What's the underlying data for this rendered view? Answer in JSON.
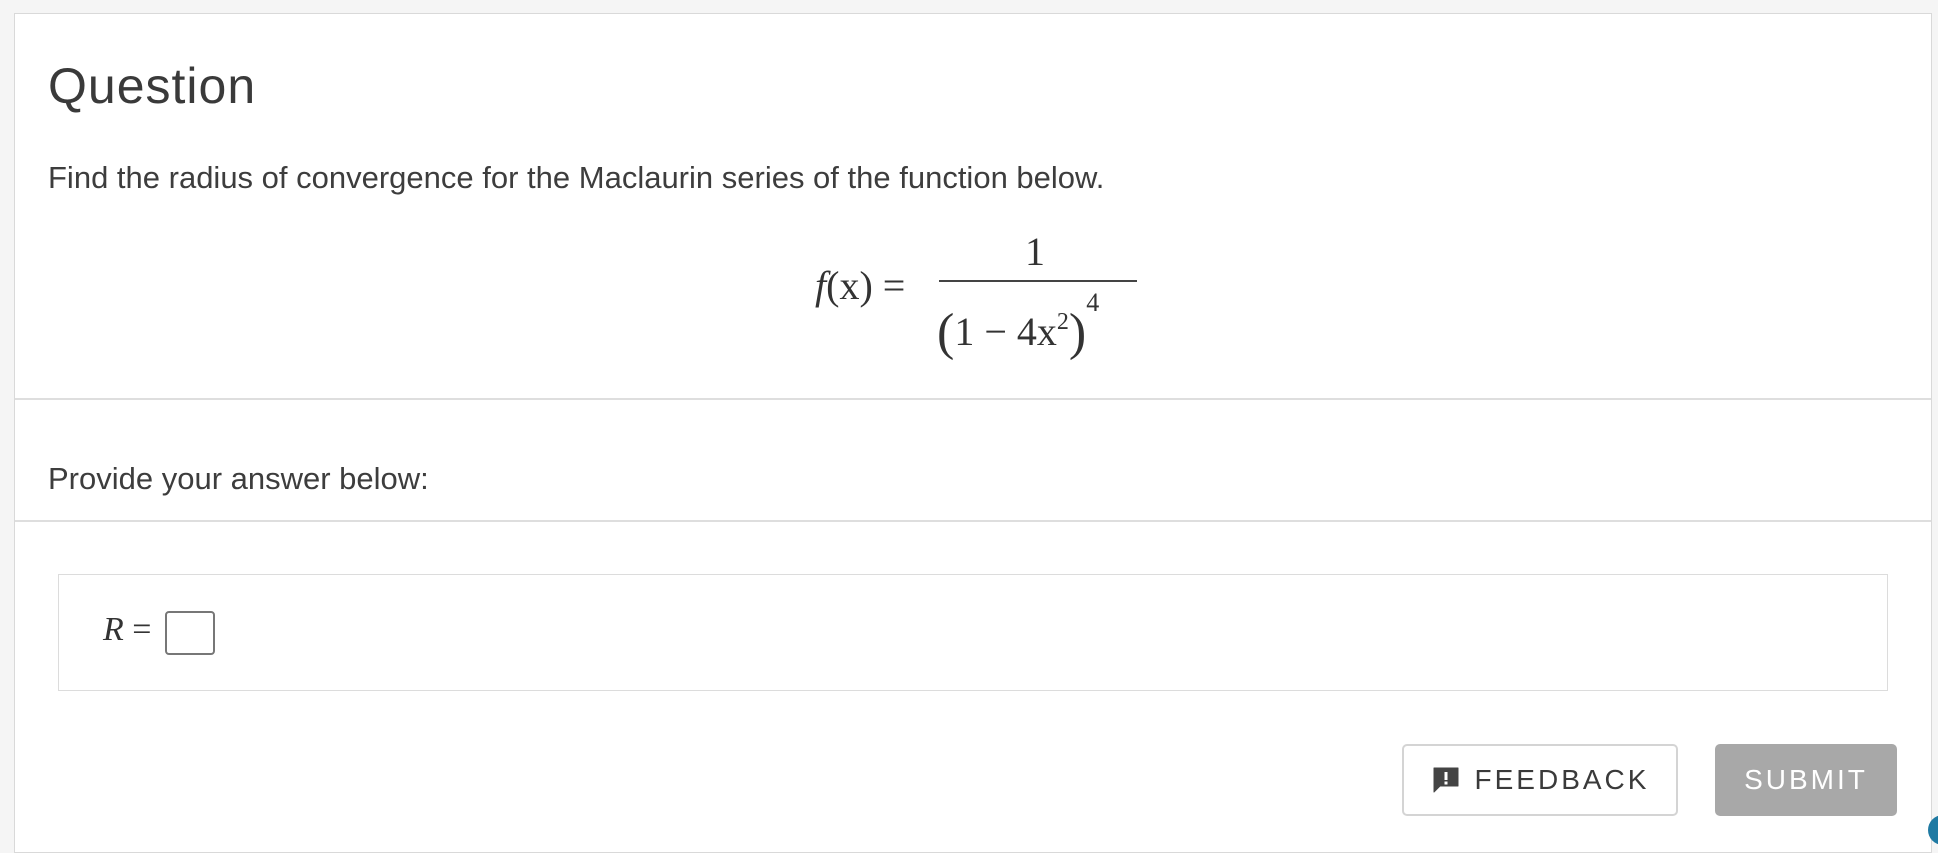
{
  "question": {
    "title": "Question",
    "prompt": "Find the radius of convergence for the Maclaurin series of the function below.",
    "formula": {
      "lhs_fn": "f",
      "lhs_var": "(x)",
      "equals": "=",
      "numerator": "1",
      "denominator_inner": "1 − 4x",
      "inner_exponent": "2",
      "outer_exponent": "4"
    }
  },
  "answer": {
    "instruction": "Provide your answer below:",
    "label_var": "R",
    "label_equals": "=",
    "input_value": ""
  },
  "buttons": {
    "feedback_label": "FEEDBACK",
    "feedback_icon": "feedback-alert-icon",
    "submit_label": "SUBMIT"
  },
  "colors": {
    "submit_bg": "#a8a8a8",
    "corner_accent": "#1f7aa3"
  }
}
